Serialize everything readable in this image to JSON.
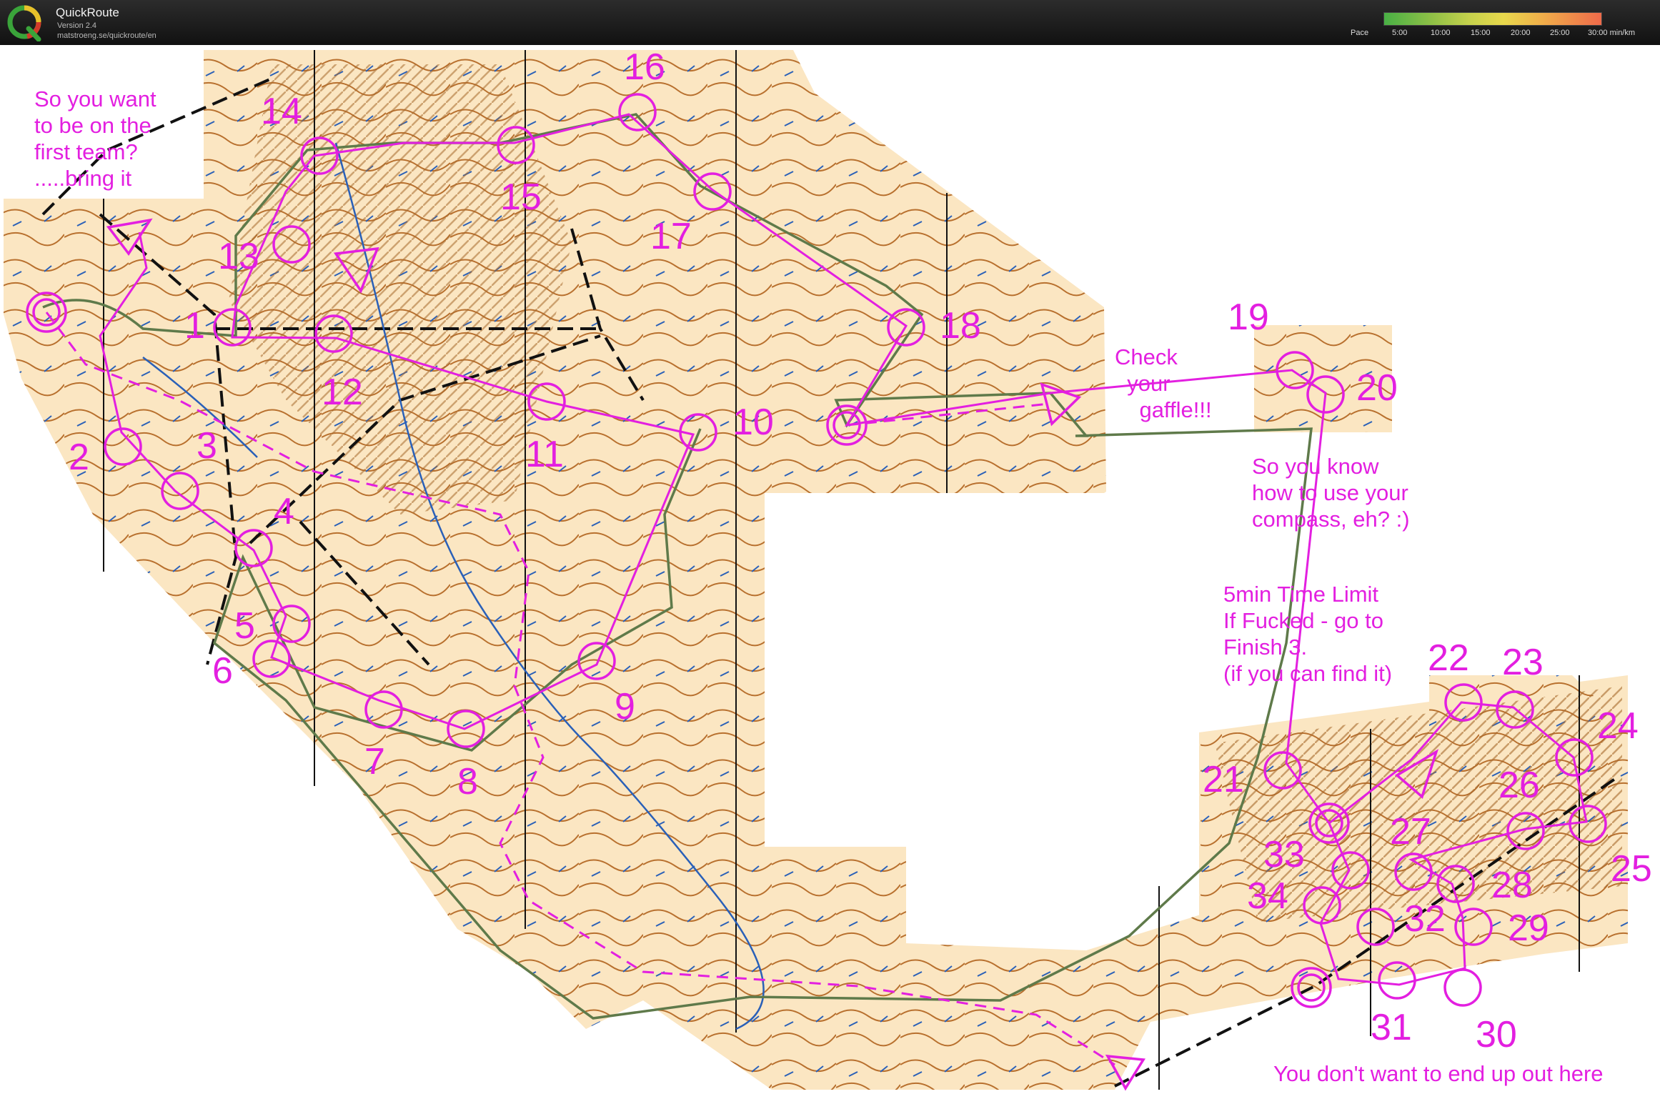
{
  "app": {
    "title": "QuickRoute",
    "version": "Version 2.4",
    "url": "matstroeng.se/quickroute/en"
  },
  "pace_scale": {
    "label": "Pace",
    "ticks": [
      "5:00",
      "10:00",
      "15:00",
      "20:00",
      "25:00",
      "30:00 min/km"
    ]
  },
  "colors": {
    "course": "#e31fe0",
    "route": "#5f7a4a",
    "terrain": "#fbe6c2",
    "contour": "#b8702e",
    "water": "#2a60b8"
  },
  "notes": {
    "first_team": "So you want\nto be on the\nfirst team?\n.....bring it",
    "gaffle": "Check\n  your\n    gaffle!!!",
    "compass": "So you know\nhow to use your\ncompass, eh? :)",
    "time_limit": "5min Time Limit\nIf Fucked - go to\nFinish 3.\n(if you can find it)",
    "out_here": "You don't want to end up out here"
  },
  "controls": [
    "1",
    "2",
    "3",
    "4",
    "5",
    "6",
    "7",
    "8",
    "9",
    "10",
    "11",
    "12",
    "13",
    "14",
    "15",
    "16",
    "17",
    "18",
    "19",
    "20",
    "21",
    "22",
    "23",
    "24",
    "25",
    "26",
    "27",
    "28",
    "29",
    "30",
    "31",
    "32",
    "33",
    "34"
  ]
}
